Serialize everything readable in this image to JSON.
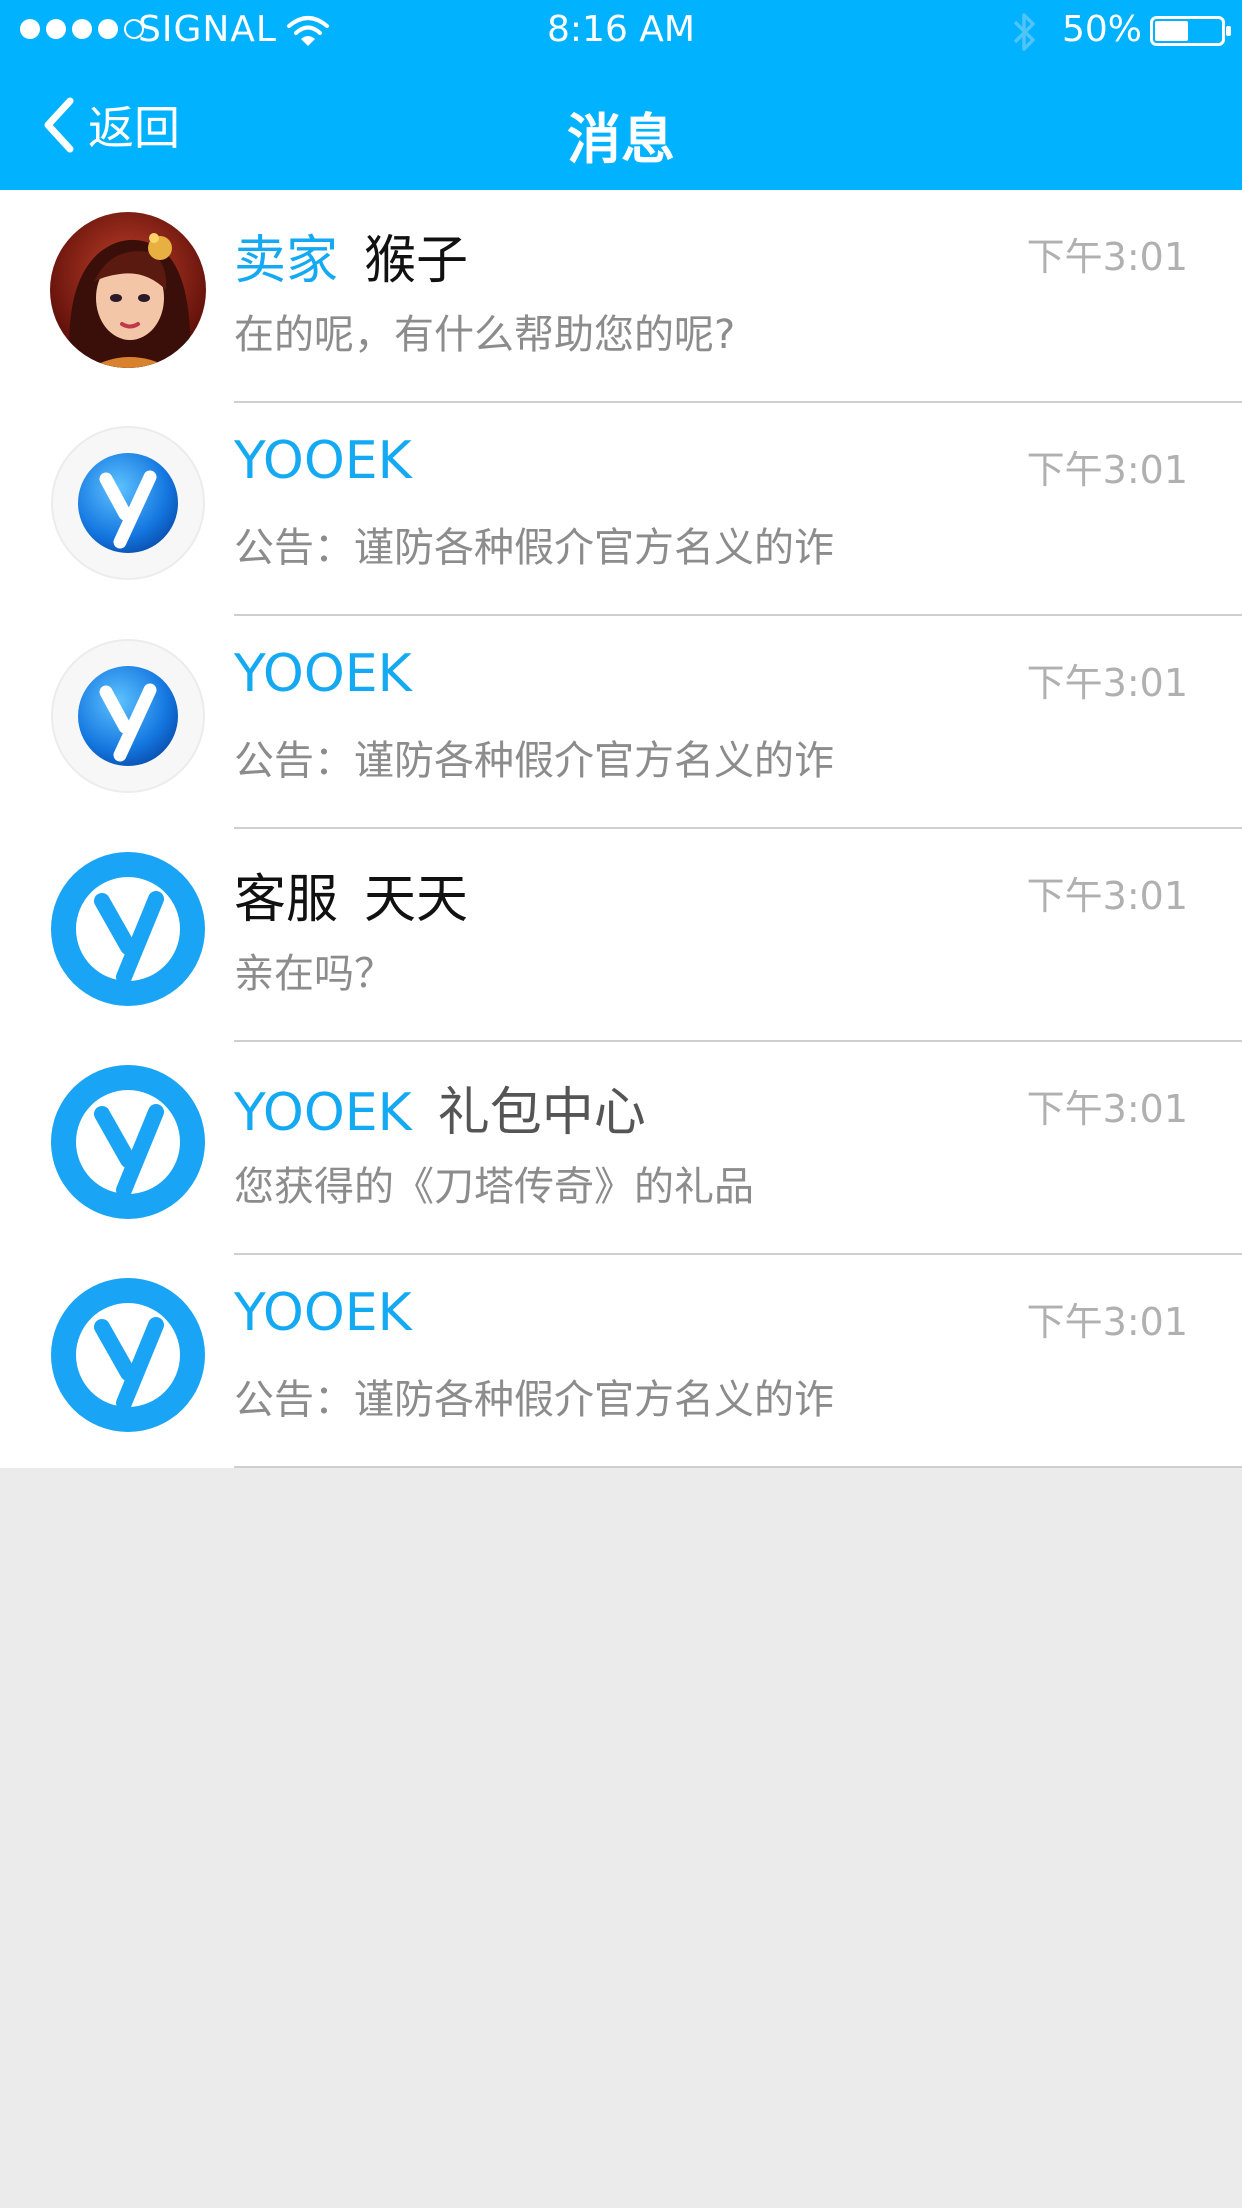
{
  "status_bar": {
    "carrier": "SIGNAL",
    "time": "8:16 AM",
    "battery": "50%",
    "battery_level": 0.5,
    "signal_strength": 4
  },
  "nav": {
    "back_label": "返回",
    "title": "消息"
  },
  "colors": {
    "header": "#00b2ff",
    "accent": "#14a9f3",
    "logo_blue": "#1aa4f5",
    "background": "#ebebeb"
  },
  "messages": [
    {
      "role": "卖家",
      "nick": "猴子",
      "time": "下午3:01",
      "preview": "在的呢，有什么帮助您的呢?",
      "avatar": "character-avatar"
    },
    {
      "role": "YOOEK",
      "nick": "",
      "time": "下午3:01",
      "preview": "公告：谨防各种假介官方名义的诈",
      "avatar": "yooek-logo-glossy-icon"
    },
    {
      "role": "YOOEK",
      "nick": "",
      "time": "下午3:01",
      "preview": "公告：谨防各种假介官方名义的诈",
      "avatar": "yooek-logo-glossy-icon"
    },
    {
      "role": "客服",
      "nick": "天天",
      "time": "下午3:01",
      "preview": "亲在吗？",
      "avatar": "yooek-logo-flat-icon"
    },
    {
      "role": "YOOEK",
      "nick": "礼包中心",
      "time": "下午3:01",
      "preview": "您获得的《刀塔传奇》的礼品",
      "avatar": "yooek-logo-flat-icon"
    },
    {
      "role": "YOOEK",
      "nick": "",
      "time": "下午3:01",
      "preview": "公告：谨防各种假介官方名义的诈",
      "avatar": "yooek-logo-flat-icon"
    }
  ]
}
